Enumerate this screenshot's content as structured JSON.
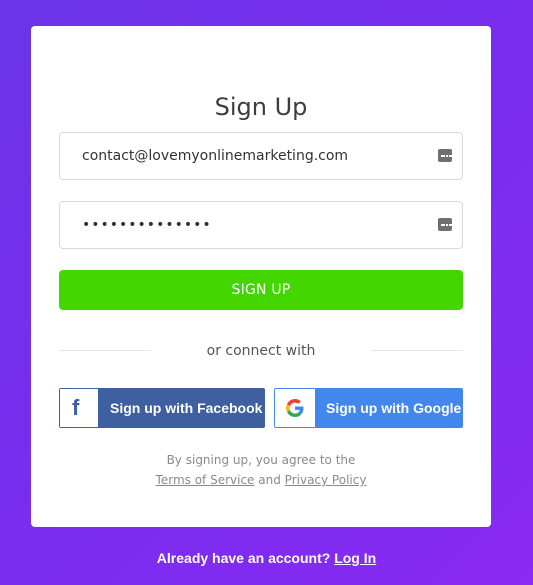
{
  "form": {
    "title": "Sign Up",
    "email_value": "contact@lovemyonlinemarketing.com",
    "password_value": "••••••••••••••",
    "signup_label": "SIGN UP",
    "divider_text": "or connect with"
  },
  "social": {
    "facebook_label": "Sign up with Facebook",
    "facebook_icon": "facebook-icon",
    "google_label": "Sign up with Google",
    "google_icon": "google-icon",
    "facebook_color": "#3e5fa0",
    "google_color": "#4286ee"
  },
  "terms": {
    "prefix": "By signing up, you agree to the",
    "tos_label": "Terms of Service",
    "and": "and",
    "privacy_label": "Privacy Policy"
  },
  "footer": {
    "text": "Already have an account?",
    "login_label": "Log In"
  },
  "colors": {
    "accent_green": "#44d600",
    "background_purple": "#7a2cf0"
  }
}
